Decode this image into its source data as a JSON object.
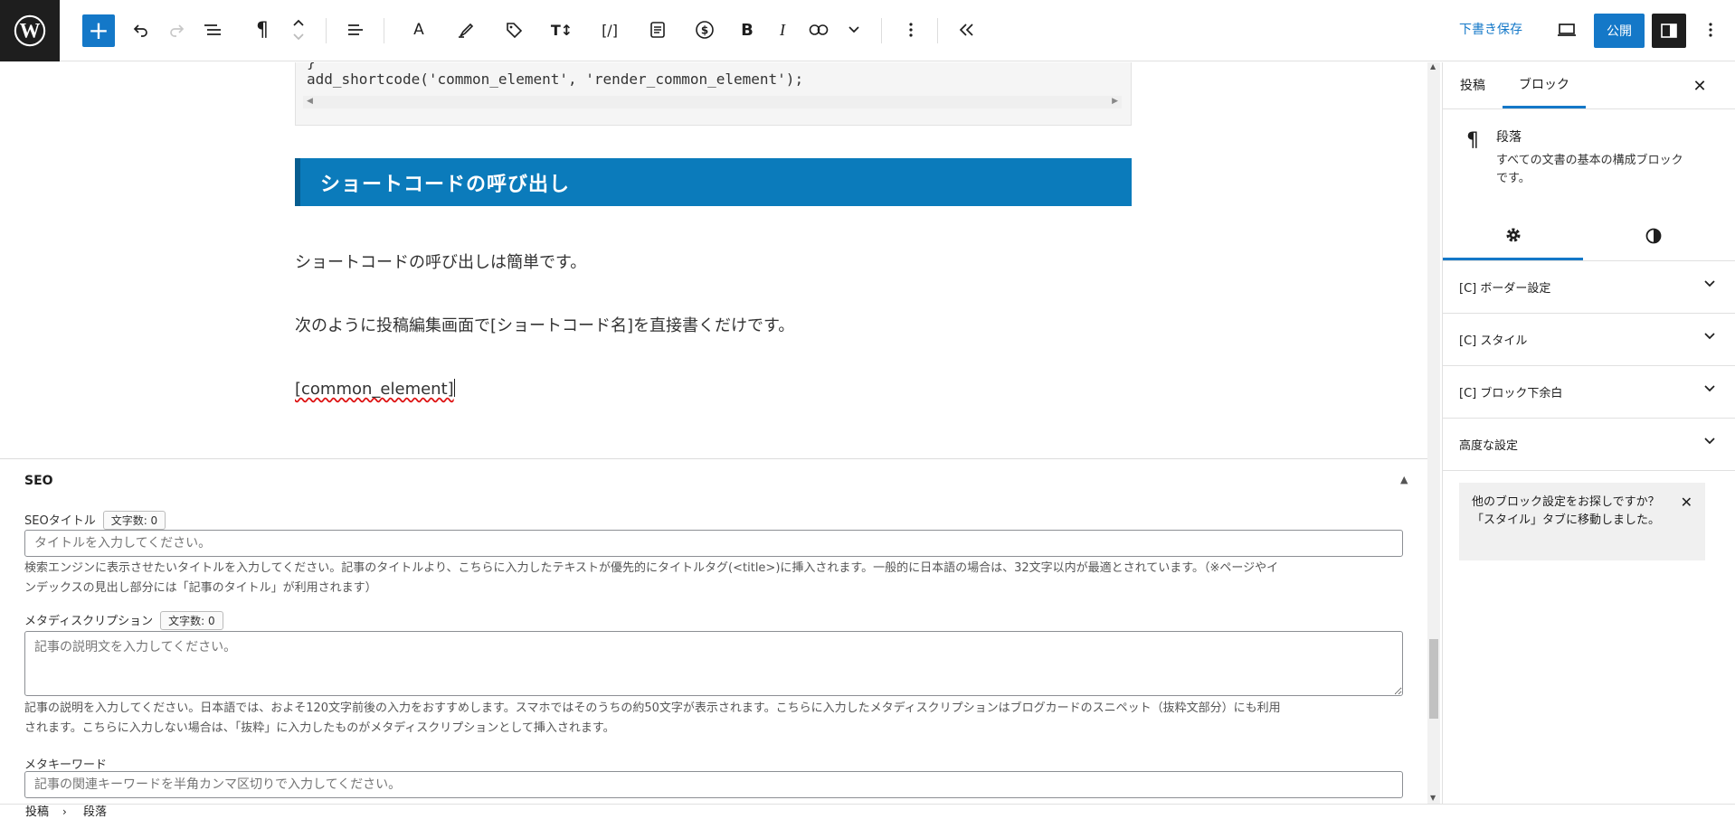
{
  "toolbar": {
    "add_block": "+",
    "draft_save_label": "下書き保存",
    "publish_label": "公開",
    "colors": {
      "accent": "#1478c8",
      "dark": "#1e1e1e"
    },
    "icons": [
      "wordpress-logo",
      "plus-icon",
      "undo-icon",
      "redo-icon",
      "list-view-icon",
      "paragraph-icon",
      "move-updown-icon",
      "align-icon",
      "font-icon",
      "highlighter-icon",
      "tag-icon",
      "text-size-icon",
      "shortcode-icon",
      "document-icon",
      "dollar-icon",
      "bold-icon",
      "italic-icon",
      "link-icon",
      "chevron-down-icon",
      "more-vertical-icon",
      "double-chevron-left-icon",
      "preview-desktop-icon",
      "sidebar-toggle-icon",
      "options-icon"
    ]
  },
  "editor": {
    "code_line": "add_shortcode('common_element', 'render_common_element');",
    "code_prev_tail": "}",
    "heading": "ショートコードの呼び出し",
    "heading_color": "#0b7bbb",
    "paragraph1": "ショートコードの呼び出しは簡単です。",
    "paragraph2": "次のように投稿編集画面で[ショートコード名]を直接書くだけです。",
    "paragraph3": "[common_element]"
  },
  "seo": {
    "title": "SEO",
    "seo_title_label": "SEOタイトル",
    "seo_title_count": "文字数: 0",
    "seo_title_placeholder": "タイトルを入力してください。",
    "seo_title_help_1": "検索エンジンに表示させたいタイトルを入力してください。記事のタイトルより、こちらに入力したテキストが優先的にタイトルタグ(<title>)に挿入されます。一般的に日本語の場合は、32文字以内が最適とされています。（※ページやイ",
    "seo_title_help_2": "ンデックスの見出し部分には「記事のタイトル」が利用されます）",
    "meta_desc_label": "メタディスクリプション",
    "meta_desc_count": "文字数: 0",
    "meta_desc_placeholder": "記事の説明文を入力してください。",
    "meta_desc_help_1": "記事の説明を入力してください。日本語では、およそ120文字前後の入力をおすすめします。スマホではそのうちの約50文字が表示されます。こちらに入力したメタディスクリプションはブログカードのスニペット（抜粋文部分）にも利用",
    "meta_desc_help_2": "されます。こちらに入力しない場合は、「抜粋」に入力したものがメタディスクリプションとして挿入されます。",
    "meta_keyword_label": "メタキーワード",
    "meta_keyword_placeholder": "記事の関連キーワードを半角カンマ区切りで入力してください。"
  },
  "sidebar": {
    "tab_post": "投稿",
    "tab_block": "ブロック",
    "block_name": "段落",
    "block_desc": "すべての文書の基本の構成ブロックです。",
    "panels": [
      {
        "label": "[C] ボーダー設定"
      },
      {
        "label": "[C] スタイル"
      },
      {
        "label": "[C] ブロック下余白"
      },
      {
        "label": "高度な設定"
      }
    ],
    "notice": "他のブロック設定をお探しですか？「スタイル」タブに移動しました。"
  },
  "footer": {
    "crumb_post": "投稿",
    "crumb_paragraph": "段落"
  }
}
